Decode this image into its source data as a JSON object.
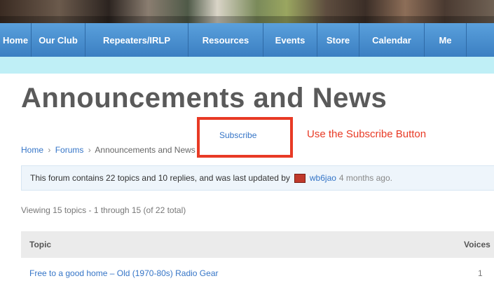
{
  "nav": {
    "items": [
      {
        "label": "Home",
        "width": 45
      },
      {
        "label": "Our Club",
        "width": 77
      },
      {
        "label": "Repeaters/IRLP",
        "width": 147
      },
      {
        "label": "Resources",
        "width": 107
      },
      {
        "label": "Events",
        "width": 77
      },
      {
        "label": "Store",
        "width": 60
      },
      {
        "label": "Calendar",
        "width": 93
      },
      {
        "label": "Me",
        "width": 60
      }
    ]
  },
  "page": {
    "title": "Announcements and News",
    "subscribe_label": "Subscribe",
    "instruction": "Use the Subscribe Button"
  },
  "breadcrumb": {
    "home": "Home",
    "separator": "›",
    "forums": "Forums",
    "current": "Announcements and News"
  },
  "info": {
    "text": "This forum contains 22 topics and 10 replies, and was last updated by",
    "user": "wb6jao",
    "time": "4 months ago."
  },
  "viewing": "Viewing 15 topics - 1 through 15 (of 22 total)",
  "table": {
    "headers": {
      "topic": "Topic",
      "voices": "Voices"
    },
    "rows": [
      {
        "topic": "Free to a good home – Old (1970-80s) Radio Gear",
        "voices": "1"
      }
    ]
  },
  "colors": {
    "nav": "#4a90d0",
    "accent_red": "#e83a25",
    "link": "#3575c7"
  }
}
